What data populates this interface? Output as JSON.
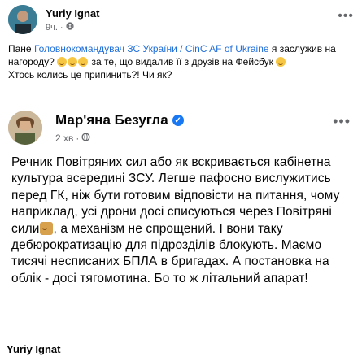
{
  "outer_post": {
    "author": "Yuriy Ignat",
    "time": "9ч.",
    "privacy_icon": "globe-icon",
    "text_before_link": "Пане ",
    "link_text": "Головнокомандувач ЗС України / CinC AF of Ukraine",
    "text_after_link": " я заслужив на нагороду? ",
    "text_after_emoji": " за те, що видалив її з друзів на Фейсбук ",
    "text_line2": "Хтось колись це припинить?! Чи як?"
  },
  "inner_post": {
    "author": "Мар'яна Безугла",
    "verified_icon": "verified-badge-icon",
    "time": "2 хв",
    "privacy_icon": "globe-icon",
    "text_part1": "Речник Повітряних сил або як вскривається кабінетна культура всередині ЗСУ. Легше пафосно виcлужитись перед ГК, ніж бути готовим відповісти на питання, чому наприклад, усі дрони досі списуються через Повітряні сили",
    "text_part2": ", а механізм не спрощений. І вони таку дебюрократизацію для підрозділів блокують. Маємо тисячі несписаних БПЛА в бригадах. А постановка на облік - досі тягомотина. Бо то ж літальний апарат!"
  },
  "footer": {
    "author": "Yuriy Ignat"
  },
  "colors": {
    "link": "#216fdb",
    "verified": "#1877f2",
    "meta": "#65676b"
  }
}
